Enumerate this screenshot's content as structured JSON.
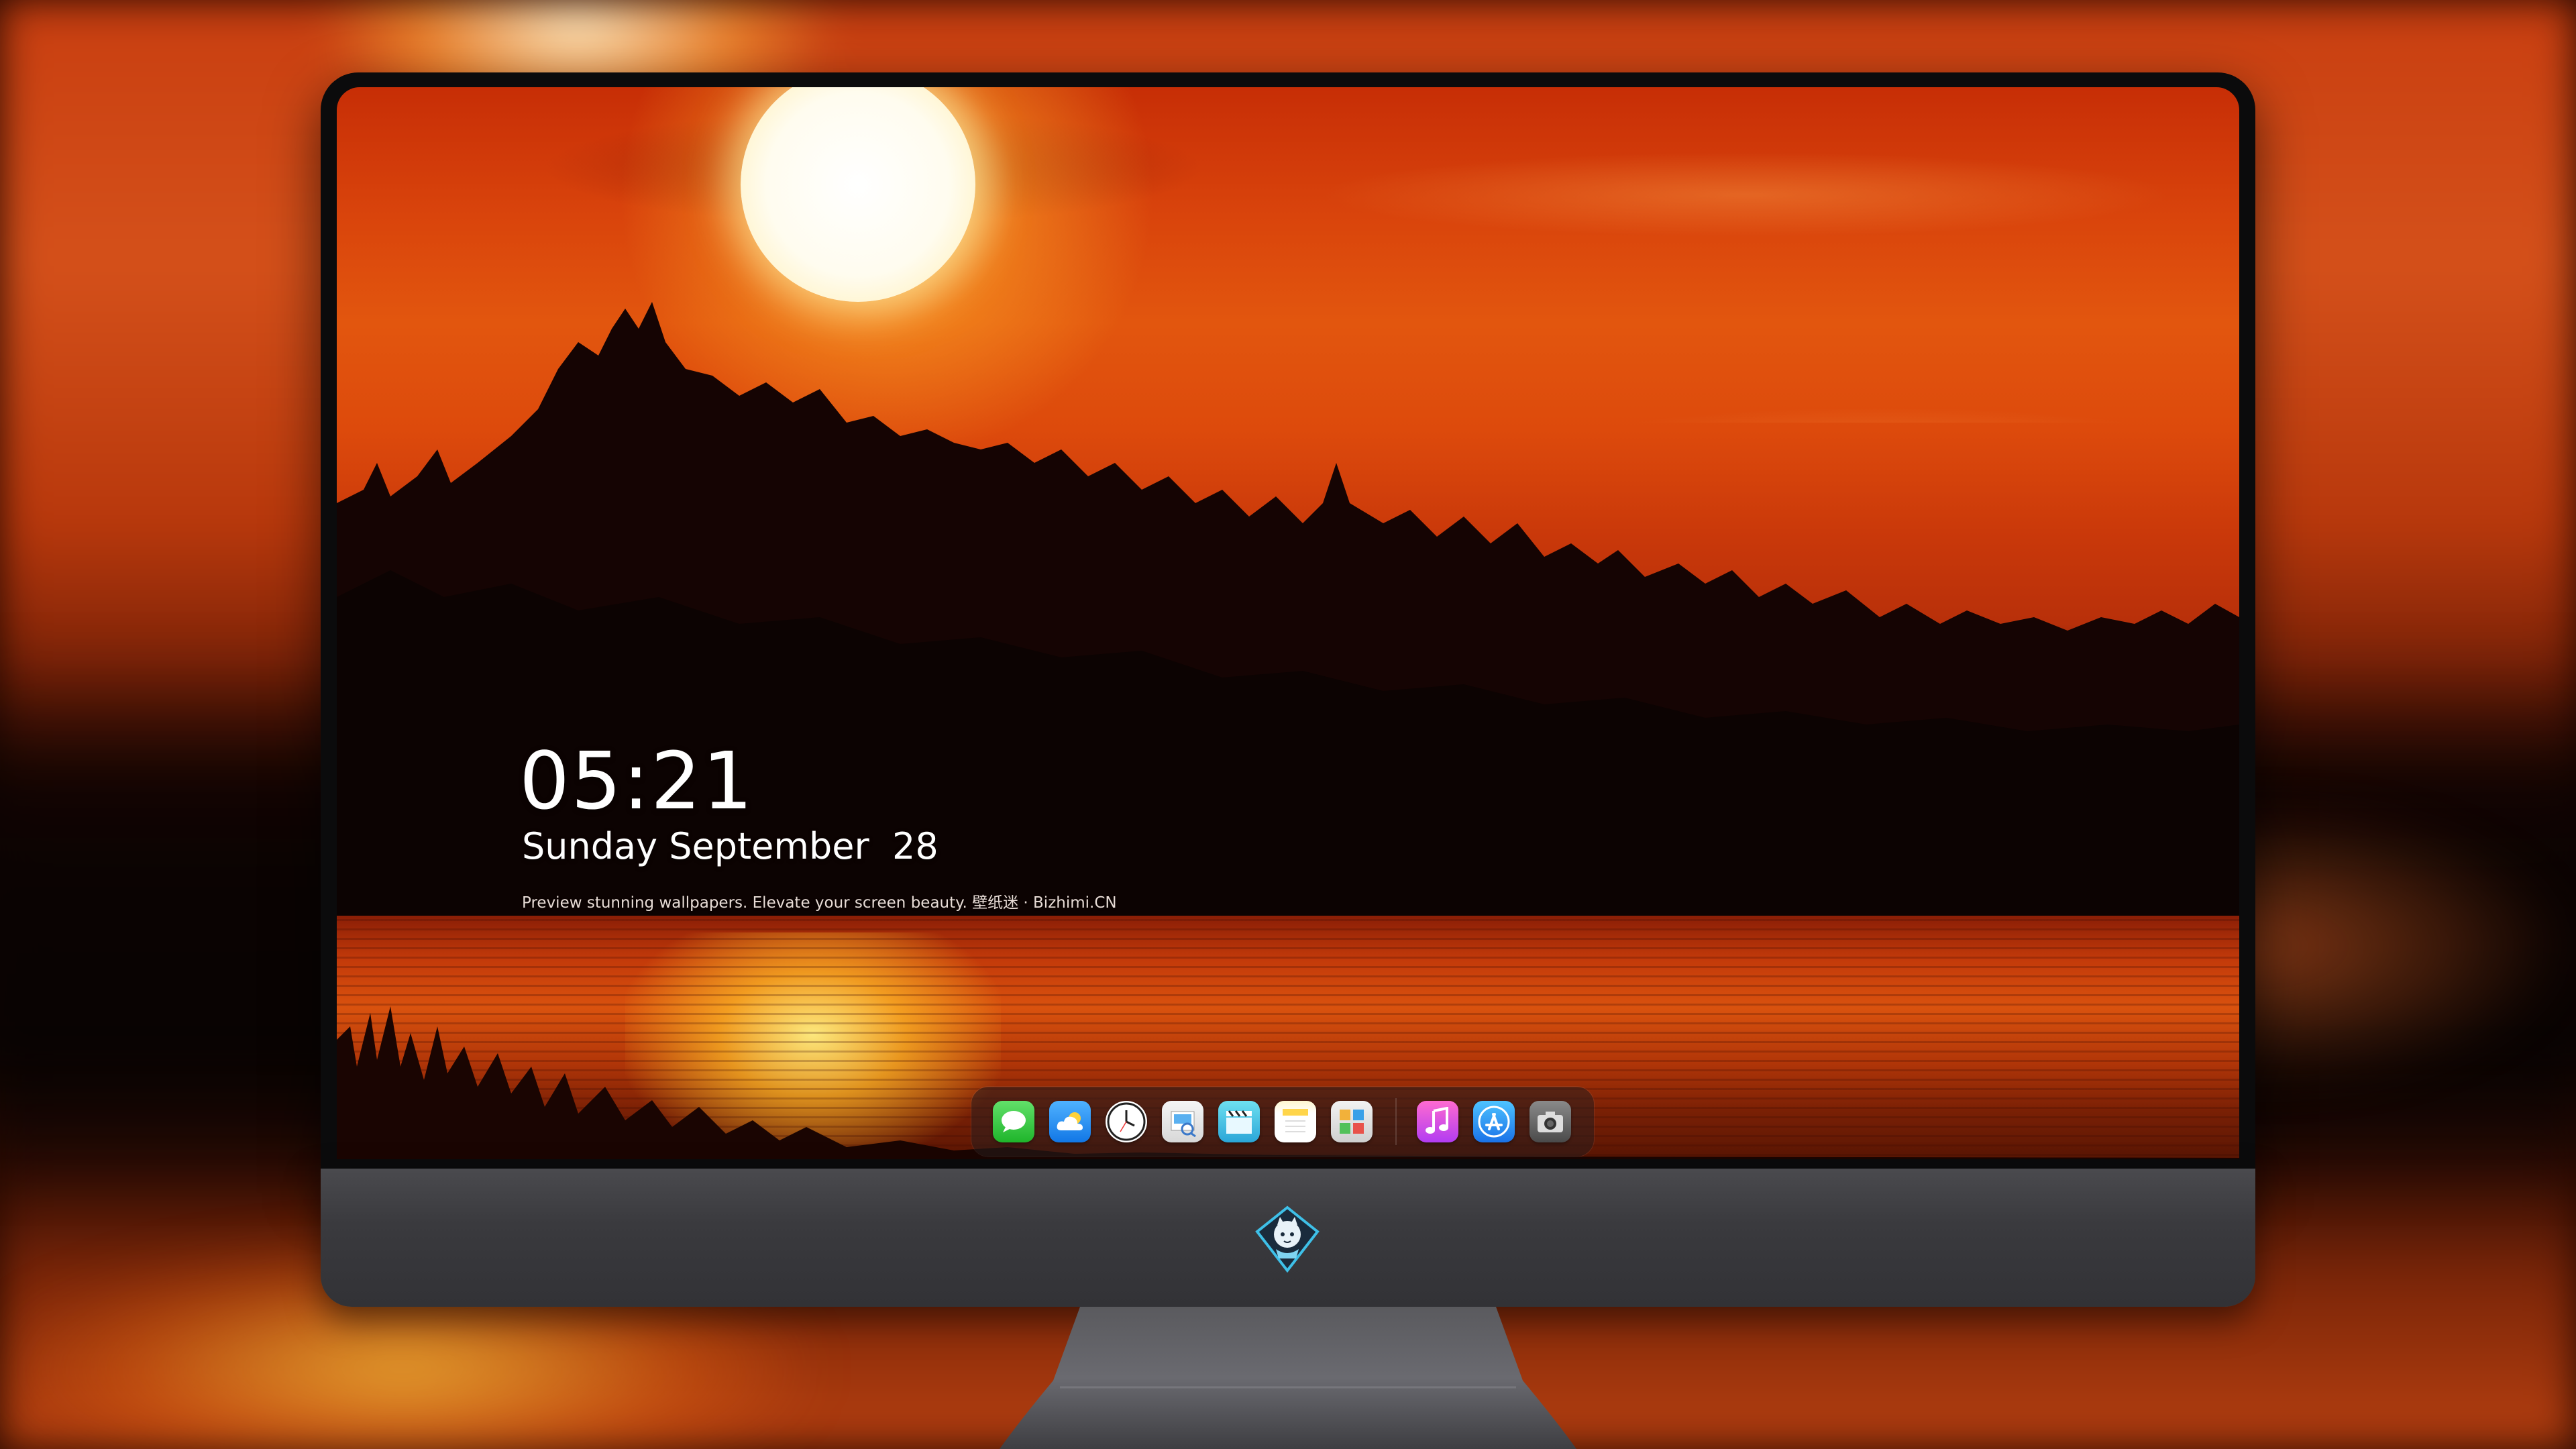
{
  "lockscreen": {
    "time": "05:21",
    "date": "Sunday September  28",
    "caption": "Preview stunning wallpapers. Elevate your screen beauty. 壁纸迷 · Bizhimi.CN"
  },
  "dock": {
    "apps": [
      {
        "name": "Messages",
        "icon": "speech-bubble-icon"
      },
      {
        "name": "Weather",
        "icon": "cloud-icon"
      },
      {
        "name": "Clock",
        "icon": "clock-icon"
      },
      {
        "name": "Preview",
        "icon": "preview-icon"
      },
      {
        "name": "Clapper",
        "icon": "clapperboard-icon"
      },
      {
        "name": "Notes",
        "icon": "notes-icon"
      },
      {
        "name": "Photos",
        "icon": "photo-booth-icon"
      },
      {
        "name": "Music",
        "icon": "music-note-icon"
      },
      {
        "name": "App Store",
        "icon": "app-store-icon"
      },
      {
        "name": "Camera",
        "icon": "camera-icon"
      }
    ]
  },
  "colors": {
    "sky": "#d9440c",
    "sun": "#fffcef",
    "monitor_chin": "#3a3a3e",
    "bezel": "#0b0b0c"
  }
}
